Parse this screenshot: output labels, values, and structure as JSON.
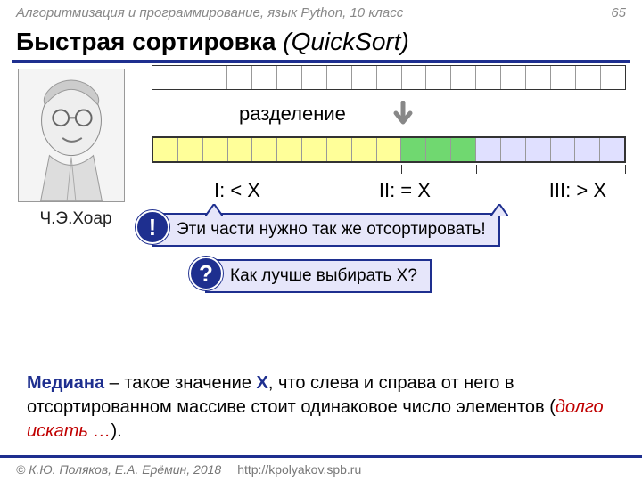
{
  "header": {
    "course": "Алгоритмизация и программирование, язык Python, 10 класс",
    "page": "65"
  },
  "title": {
    "main": "Быстрая сортировка",
    "paren": "(QuickSort)"
  },
  "portrait": {
    "caption": "Ч.Э.Хоар"
  },
  "diagram": {
    "split_label": "разделение",
    "part1": "I: < X",
    "part2": "II: = X",
    "part3": "III: > X"
  },
  "callout1": {
    "badge": "!",
    "text": "Эти части нужно так же отсортировать!"
  },
  "callout2": {
    "badge": "?",
    "text": "Как лучше выбирать X?"
  },
  "median": {
    "term": "Медиана",
    "body1": " – такое значение ",
    "x": "X",
    "body2": ", что слева и справа от него в отсортированном массиве стоит одинаковое число элементов (",
    "note": "долго искать …",
    "body3": ")."
  },
  "footer": {
    "copyright": "© К.Ю. Поляков, Е.А. Ерёмин, 2018",
    "url": "http://kpolyakov.spb.ru"
  }
}
